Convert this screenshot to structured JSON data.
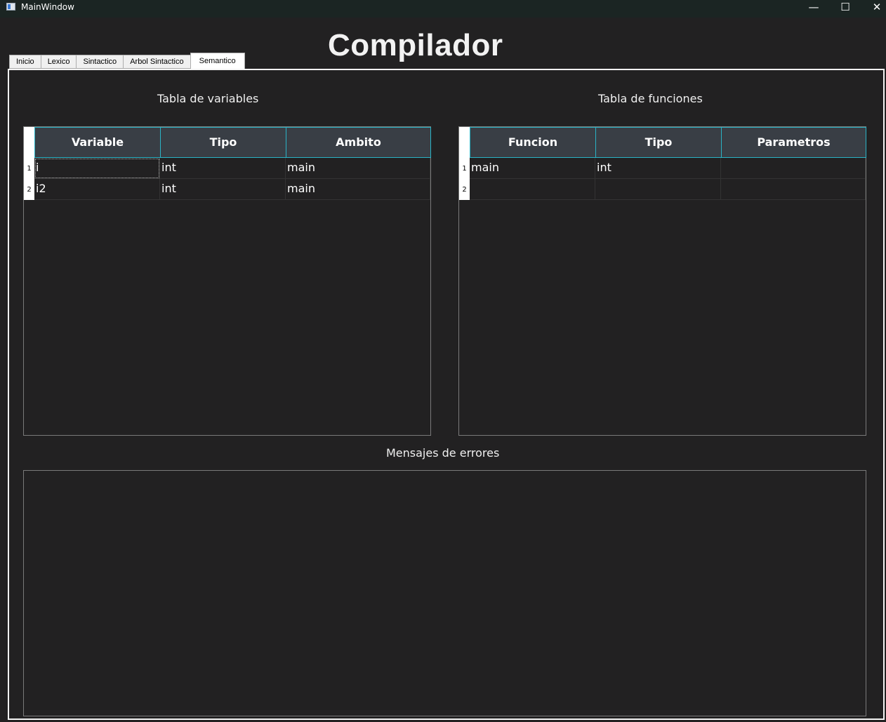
{
  "window": {
    "title": "MainWindow",
    "minimize": "—",
    "maximize": "☐",
    "close": "✕"
  },
  "header": {
    "title": "Compilador"
  },
  "tabs": [
    {
      "label": "Inicio",
      "active": false
    },
    {
      "label": "Lexico",
      "active": false
    },
    {
      "label": "Sintactico",
      "active": false
    },
    {
      "label": "Arbol Sintactico",
      "active": false
    },
    {
      "label": "Semantico",
      "active": true
    }
  ],
  "variables": {
    "label": "Tabla de variables",
    "columns": [
      "Variable",
      "Tipo",
      "Ambito"
    ],
    "rows": [
      {
        "num": "1",
        "cells": [
          "i",
          "int",
          "main"
        ]
      },
      {
        "num": "2",
        "cells": [
          "i2",
          "int",
          "main"
        ]
      }
    ]
  },
  "functions": {
    "label": "Tabla de funciones",
    "columns": [
      "Funcion",
      "Tipo",
      "Parametros"
    ],
    "rows": [
      {
        "num": "1",
        "cells": [
          "main",
          "int",
          ""
        ]
      },
      {
        "num": "2",
        "cells": [
          "",
          "",
          ""
        ]
      }
    ]
  },
  "errors": {
    "label": "Mensajes de errores",
    "text": ""
  },
  "colors": {
    "background": "#222122",
    "header_cell": "#393e45",
    "header_border": "#2ab3c6",
    "titlebar": "#1b2523"
  }
}
